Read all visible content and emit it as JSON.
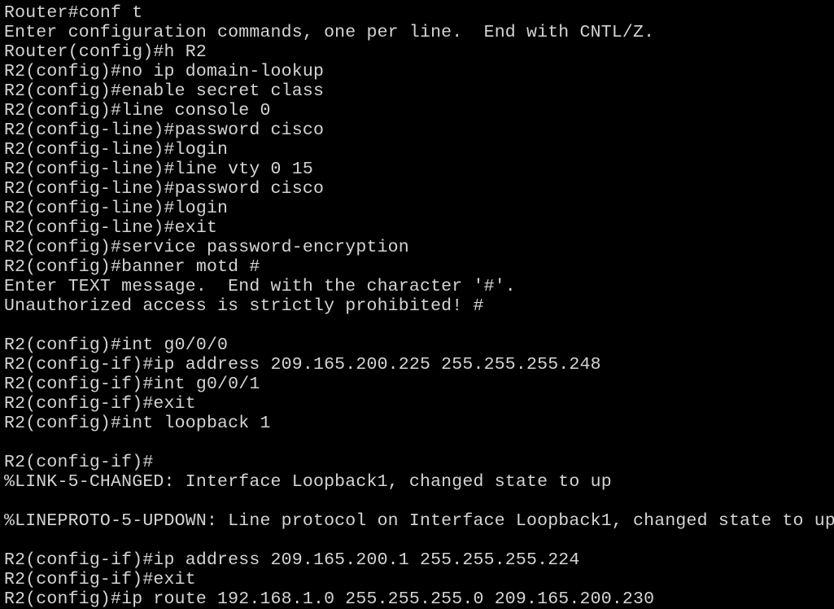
{
  "colors": {
    "background": "#000000",
    "text": "#d4d4d4"
  },
  "terminal": {
    "lines": [
      "Router#conf t",
      "Enter configuration commands, one per line.  End with CNTL/Z.",
      "Router(config)#h R2",
      "R2(config)#no ip domain-lookup",
      "R2(config)#enable secret class",
      "R2(config)#line console 0",
      "R2(config-line)#password cisco",
      "R2(config-line)#login",
      "R2(config-line)#line vty 0 15",
      "R2(config-line)#password cisco",
      "R2(config-line)#login",
      "R2(config-line)#exit",
      "R2(config)#service password-encryption",
      "R2(config)#banner motd #",
      "Enter TEXT message.  End with the character '#'.",
      "Unauthorized access is strictly prohibited! #",
      "",
      "R2(config)#int g0/0/0",
      "R2(config-if)#ip address 209.165.200.225 255.255.255.248",
      "R2(config-if)#int g0/0/1",
      "R2(config-if)#exit",
      "R2(config)#int loopback 1",
      "",
      "R2(config-if)#",
      "%LINK-5-CHANGED: Interface Loopback1, changed state to up",
      "",
      "%LINEPROTO-5-UPDOWN: Line protocol on Interface Loopback1, changed state to up",
      "",
      "R2(config-if)#ip address 209.165.200.1 255.255.255.224",
      "R2(config-if)#exit",
      "R2(config)#ip route 192.168.1.0 255.255.255.0 209.165.200.230"
    ]
  }
}
